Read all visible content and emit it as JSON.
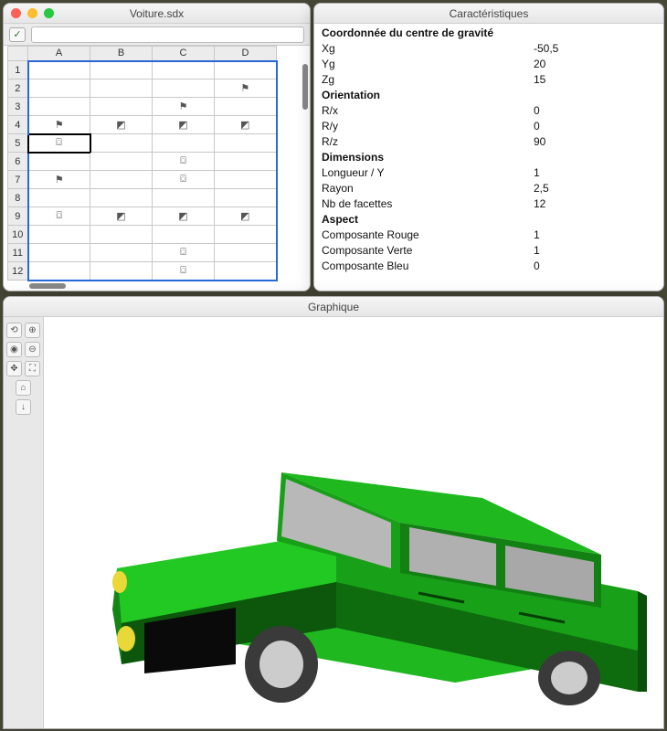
{
  "spreadsheet": {
    "title": "Voiture.sdx",
    "columns": [
      "A",
      "B",
      "C",
      "D"
    ],
    "rows": [
      "1",
      "2",
      "3",
      "4",
      "5",
      "6",
      "7",
      "8",
      "9",
      "10",
      "11",
      "12"
    ],
    "active_cell": "A5",
    "cells": {
      "D2": "flag",
      "C3": "flag",
      "A4": "flag",
      "B4": "crop",
      "C4": "crop",
      "D4": "crop",
      "A5": "cyl",
      "C6": "cyl",
      "A7": "flag",
      "C7": "cyl",
      "A9": "cyl",
      "B9": "crop",
      "C9": "crop",
      "D9": "crop",
      "C11": "cyl",
      "C12": "cyl"
    },
    "icons": {
      "flag": "⚑",
      "crop": "◩",
      "cyl": "⌼"
    }
  },
  "properties": {
    "title": "Caractéristiques",
    "groups": [
      {
        "header": "Coordonnée du centre de gravité",
        "rows": [
          {
            "label": "Xg",
            "value": "-50,5"
          },
          {
            "label": "Yg",
            "value": "20"
          },
          {
            "label": "Zg",
            "value": "15"
          }
        ]
      },
      {
        "header": "Orientation",
        "rows": [
          {
            "label": "R/x",
            "value": "0"
          },
          {
            "label": "R/y",
            "value": "0"
          },
          {
            "label": "R/z",
            "value": "90"
          }
        ]
      },
      {
        "header": "Dimensions",
        "rows": [
          {
            "label": "Longueur / Y",
            "value": "1"
          },
          {
            "label": "Rayon",
            "value": "2,5"
          },
          {
            "label": "Nb de facettes",
            "value": "12"
          }
        ]
      },
      {
        "header": "Aspect",
        "rows": [
          {
            "label": "Composante Rouge",
            "value": "1"
          },
          {
            "label": "Composante Verte",
            "value": "1"
          },
          {
            "label": "Composante Bleu",
            "value": "0"
          }
        ]
      }
    ]
  },
  "graphics": {
    "title": "Graphique",
    "tools": [
      "rotate",
      "zoom-in",
      "orbit",
      "zoom-out",
      "pan",
      "fit",
      "home",
      "down"
    ],
    "car_colors": {
      "body": "#1fb81f",
      "body_shadow": "#148514",
      "body_dark": "#0e6b0e",
      "window": "#b8b8b8",
      "tire": "#4a4a4a",
      "hub": "#cccccc",
      "light": "#e8d838"
    }
  }
}
